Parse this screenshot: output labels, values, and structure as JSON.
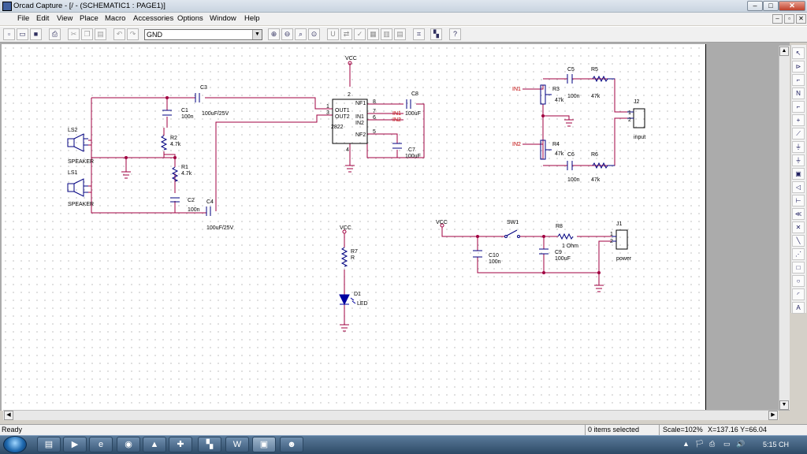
{
  "window": {
    "title": "Orcad Capture - [/ - (SCHEMATIC1 : PAGE1)]",
    "min": "‒",
    "max": "□",
    "close": "✕"
  },
  "menu": {
    "items": [
      "File",
      "Edit",
      "View",
      "Place",
      "Macro",
      "Accessories",
      "Options",
      "Window",
      "Help"
    ],
    "mdi": [
      "‒",
      "▫",
      "✕"
    ]
  },
  "toolbar": {
    "part_value": "GND"
  },
  "status": {
    "ready": "Ready",
    "selection": "0 items selected",
    "scale": "Scale=102%",
    "coords": "X=137.16  Y=66.04"
  },
  "taskbar": {
    "tray": [
      "▲",
      "🏳",
      "⎙",
      "▭",
      "🔊"
    ],
    "clock": "5:15 CH"
  },
  "schematic": {
    "labels": {
      "vcc": "VCC",
      "ls2": "LS2",
      "ls1": "LS1",
      "speaker": "SPEAKER",
      "c1": "C1",
      "c1v": "100n",
      "c2": "C2",
      "c2v": "100n",
      "c3": "C3",
      "c3v": "100uF/25V",
      "c4": "C4",
      "c4v": "100uF/25V",
      "r1": "R1",
      "r1v": "4.7k",
      "r2": "R2",
      "r2v": "4.7k",
      "u_out1": "OUT1",
      "u_out2": "OUT2",
      "u_vcc": "VCC",
      "u_gnd": "GND",
      "u_nf1": "NF1",
      "u_in1": "IN1",
      "u_in2": "IN2",
      "u_nf2": "NF2",
      "u_part": "2822",
      "p1": "1",
      "p3": "3",
      "p2": "2",
      "p4": "4",
      "p5": "5",
      "p6": "6",
      "p7": "7",
      "p8": "8",
      "in1": "IN1",
      "in2": "IN2",
      "c8": "C8",
      "c8v": "100uF",
      "c7": "C7",
      "c7v": "100uF",
      "r3": "R3",
      "r3v": "47k",
      "r4": "R4",
      "r4v": "47k",
      "r5": "R5",
      "r5v": "47k",
      "r6": "R6",
      "r6v": "47k",
      "c5": "C5",
      "c5v": "100n",
      "c6": "C6",
      "c6v": "100n",
      "j2": "J2",
      "j2v": "input",
      "r7": "R7",
      "r7v": "R",
      "d1": "D1",
      "d1v": "LED",
      "sw1": "SW1",
      "r8": "R8",
      "r8v": "1 Ohm",
      "c10": "C10",
      "c10v": "100n",
      "c9": "C9",
      "c9v": "100uF",
      "j1": "J1",
      "j1v": "power"
    }
  }
}
